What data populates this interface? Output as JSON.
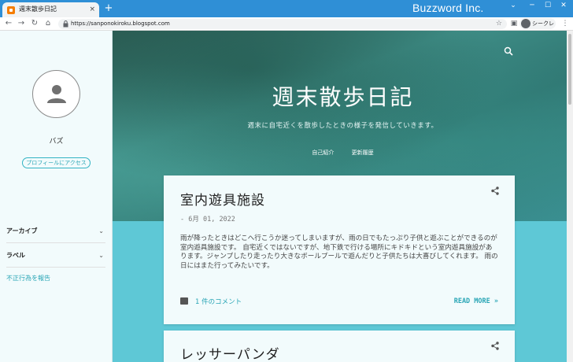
{
  "browser": {
    "tab_title": "週末散歩日記",
    "tab_close": "×",
    "new_tab": "+",
    "brand": "Buzzword Inc.",
    "url": "https://sanponokiroku.blogspot.com",
    "incognito_label": "シークレット",
    "window_controls": {
      "minimize": "─",
      "maximize": "☐",
      "close": "✕",
      "chevron": "⌄"
    },
    "nav": {
      "back": "←",
      "forward": "→",
      "reload": "↻",
      "home": "⌂"
    },
    "menu": "⋮"
  },
  "sidebar": {
    "username": "バズ",
    "profile_button": "プロフィールにアクセス",
    "items": [
      {
        "label": "アーカイブ",
        "chev": "⌄"
      },
      {
        "label": "ラベル",
        "chev": "⌄"
      }
    ],
    "report_link": "不正行為を報告"
  },
  "hero": {
    "title": "週末散歩日記",
    "subtitle": "週末に自宅近くを散歩したときの様子を発信していきます。",
    "links": [
      "自己紹介",
      "更新履歴"
    ]
  },
  "posts": [
    {
      "title": "室内遊具施設",
      "date": "- 6月 01, 2022",
      "body": "雨が降ったときはどこへ行こうか迷ってしまいますが、雨の日でもたっぷり子供と遊ぶことができるのが室内遊具施設です。 自宅近くではないですが、地下鉄で行ける場所にキドキドという室内遊具施設があります。ジャンプしたり走ったり大きなボールプールで遊んだりと子供たちは大喜びしてくれます。 雨の日にはまた行ってみたいです。",
      "comments": "1 件のコメント",
      "read_more": "READ MORE »"
    },
    {
      "title": "レッサーパンダ"
    }
  ],
  "colors": {
    "accent": "#2aa6b6",
    "background": "#5ec8d6",
    "titlebar": "#2f8fd6"
  }
}
